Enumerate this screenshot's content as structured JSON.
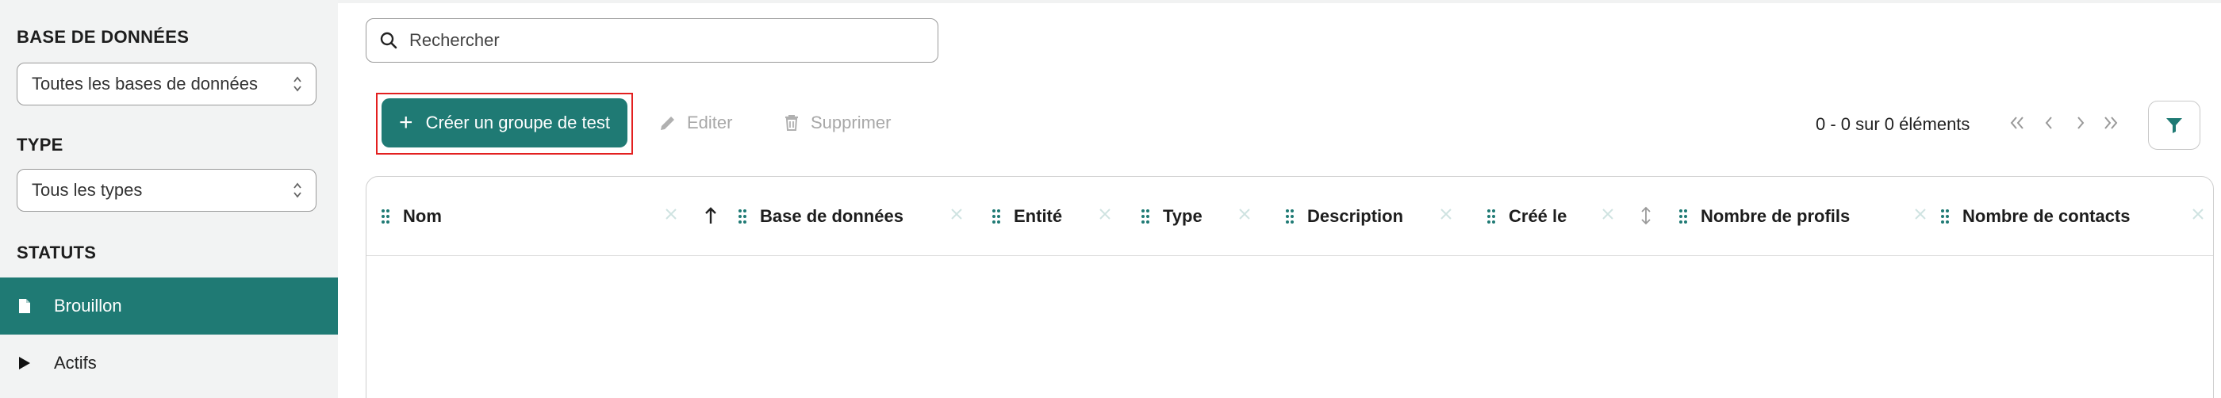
{
  "sidebar": {
    "database_section": "BASE DE DONNÉES",
    "database_select": "Toutes les bases de données",
    "type_section": "TYPE",
    "type_select": "Tous les types",
    "status_section": "STATUTS",
    "status_items": [
      {
        "label": "Brouillon",
        "icon": "document-icon",
        "active": true
      },
      {
        "label": "Actifs",
        "icon": "play-icon",
        "active": false
      }
    ]
  },
  "search": {
    "placeholder": "Rechercher"
  },
  "toolbar": {
    "create_label": "Créer un groupe de test",
    "edit_label": "Editer",
    "delete_label": "Supprimer"
  },
  "pager": {
    "text": "0 - 0 sur 0 éléments"
  },
  "table": {
    "columns": [
      "Nom",
      "Base de données",
      "Entité",
      "Type",
      "Description",
      "Créé le",
      "Nombre de profils",
      "Nombre de contacts"
    ]
  },
  "colors": {
    "accent": "#1f7a74",
    "highlight": "#e32020",
    "sidebar_bg": "#f2f3f3"
  }
}
